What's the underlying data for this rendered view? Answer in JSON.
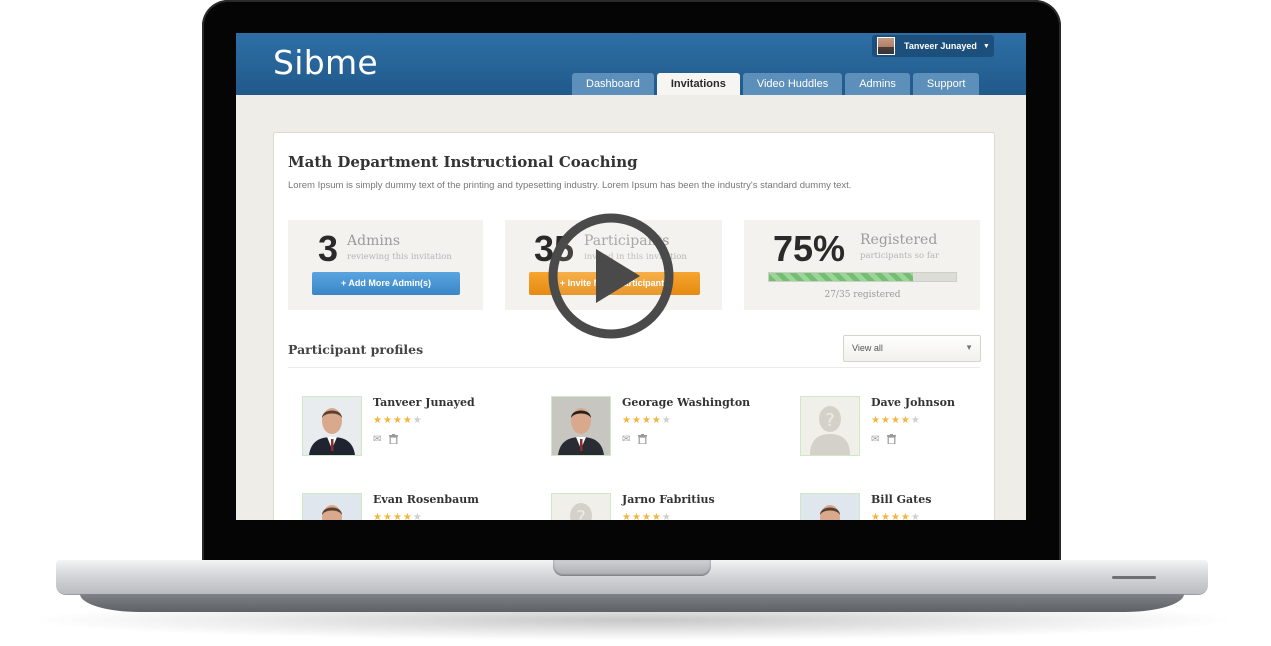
{
  "app": {
    "logo": "Sibme",
    "user_name": "Tanveer Junayed",
    "tabs": [
      {
        "label": "Dashboard",
        "active": false
      },
      {
        "label": "Invitations",
        "active": true
      },
      {
        "label": "Video Huddles",
        "active": false
      },
      {
        "label": "Admins",
        "active": false
      },
      {
        "label": "Support",
        "active": false
      }
    ]
  },
  "invitation": {
    "title": "Math Department Instructional Coaching",
    "description": "Lorem Ipsum is simply dummy text of the printing and typesetting industry. Lorem Ipsum has been the industry's standard dummy text."
  },
  "stats": {
    "admins": {
      "count": "3",
      "label": "Admins",
      "sub": "reviewing this invitation",
      "button": "+ Add More Admin(s)"
    },
    "participants": {
      "count": "35",
      "label": "Participants",
      "sub": "invited in this invitation",
      "button": "+ Invite More Participants"
    },
    "registered": {
      "percent_text": "75%",
      "label": "Registered",
      "sub": "participants so far",
      "progress": 0.77,
      "count_text": "27/35 registered"
    }
  },
  "profiles": {
    "title": "Participant profiles",
    "filter_value": "View all",
    "items": [
      {
        "name": "Tanveer Junayed",
        "rating": 4,
        "photo": "man-suit"
      },
      {
        "name": "Georage Washington",
        "rating": 4,
        "photo": "man-dark"
      },
      {
        "name": "Dave Johnson",
        "rating": 4,
        "photo": "placeholder"
      },
      {
        "name": "Evan Rosenbaum",
        "rating": 4,
        "photo": "man-light"
      },
      {
        "name": "Jarno Fabritius",
        "rating": 4,
        "photo": "placeholder"
      },
      {
        "name": "Bill Gates",
        "rating": 4,
        "photo": "man-light"
      }
    ]
  },
  "icons": {
    "play": "play-icon",
    "mail": "mail-icon",
    "trash": "trash-icon",
    "caret": "chevron-down-icon"
  },
  "colors": {
    "header_blue": "#2d6fa5",
    "button_blue": "#3a86c6",
    "button_orange": "#e58a11",
    "progress_green": "#74be72",
    "star": "#f3b63c"
  }
}
